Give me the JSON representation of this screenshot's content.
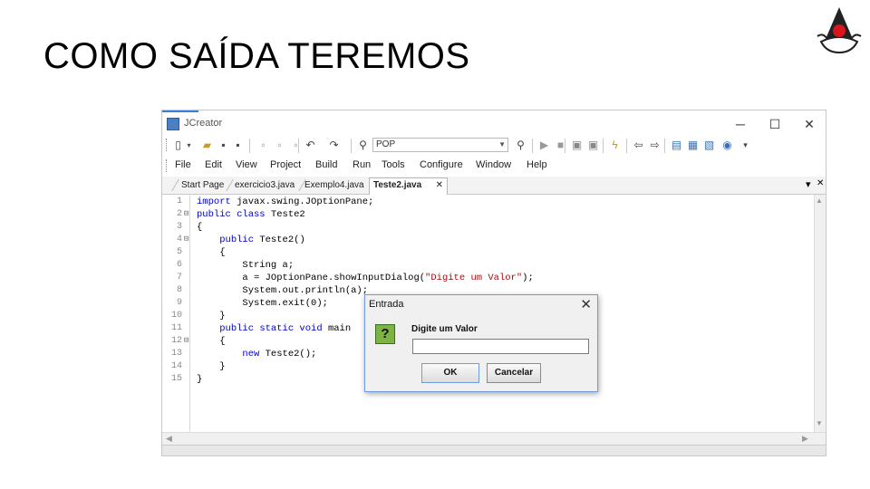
{
  "slide": {
    "title": "COMO SAÍDA TEREMOS"
  },
  "window": {
    "title": "JCreator",
    "controls": {
      "minimize": "─",
      "maximize": "☐",
      "close": "✕"
    }
  },
  "toolbar": {
    "combo_value": "POP"
  },
  "menu": [
    "File",
    "Edit",
    "View",
    "Project",
    "Build",
    "Run",
    "Tools",
    "Configure",
    "Window",
    "Help"
  ],
  "tabs": [
    {
      "label": "Start Page",
      "active": false
    },
    {
      "label": "exercicio3.java",
      "active": false
    },
    {
      "label": "Exemplo4.java",
      "active": false
    },
    {
      "label": "Teste2.java",
      "active": true,
      "close": "✕"
    }
  ],
  "tab_dropdown": "▾",
  "tab_close_all": "✕",
  "editor": {
    "line_numbers": [
      "1",
      "2",
      "3",
      "4",
      "5",
      "6",
      "7",
      "8",
      "9",
      "10",
      "11",
      "12",
      "13",
      "14",
      "15"
    ],
    "code_lines": [
      "import javax.swing.JOptionPane;",
      "public class Teste2",
      "{",
      "    public Teste2()",
      "    {",
      "        String a;",
      "        a = JOptionPane.showInputDialog(\"Digite um Valor\");",
      "        System.out.println(a);",
      "        System.exit(0);",
      "    }",
      "    public static void main",
      "    {",
      "        new Teste2();",
      "    }",
      "}"
    ]
  },
  "dialog": {
    "title": "Entrada",
    "close": "✕",
    "icon_glyph": "?",
    "prompt": "Digite um Valor",
    "input_value": "",
    "ok_label": "OK",
    "cancel_label": "Cancelar"
  }
}
